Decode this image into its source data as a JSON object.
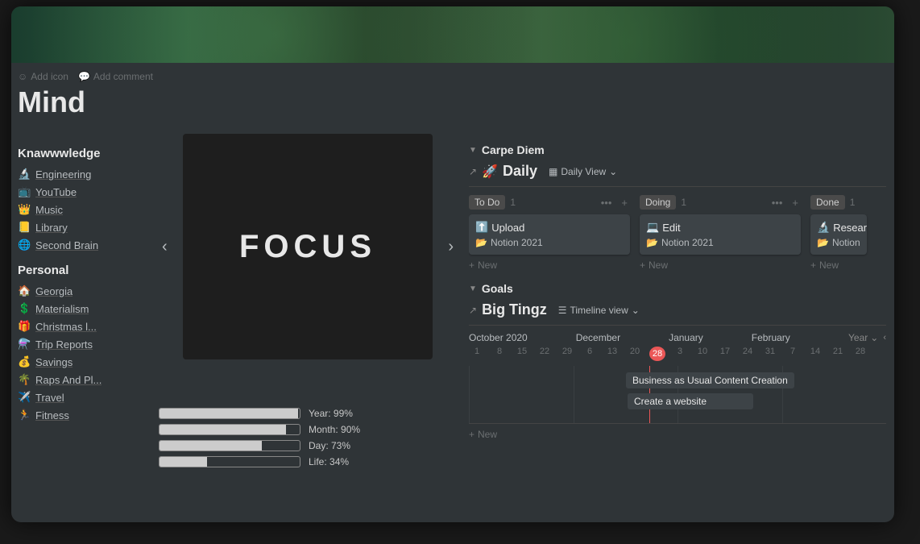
{
  "meta": {
    "add_icon": "Add icon",
    "add_comment": "Add comment"
  },
  "page_title": "Mind",
  "knowledge": {
    "heading": "Knawwwledge",
    "items": [
      {
        "emoji": "🔬",
        "label": "Engineering"
      },
      {
        "emoji": "📺",
        "label": "YouTube"
      },
      {
        "emoji": "👑",
        "label": "Music"
      },
      {
        "emoji": "📒",
        "label": "Library"
      },
      {
        "emoji": "🌐",
        "label": "Second Brain"
      }
    ]
  },
  "personal": {
    "heading": "Personal",
    "items": [
      {
        "emoji": "🏠",
        "label": "Georgia"
      },
      {
        "emoji": "💲",
        "label": "Materialism"
      },
      {
        "emoji": "🎁",
        "label": "Christmas l..."
      },
      {
        "emoji": "⚗️",
        "label": "Trip Reports"
      },
      {
        "emoji": "💰",
        "label": "Savings"
      },
      {
        "emoji": "🌴",
        "label": "Raps And Pl..."
      },
      {
        "emoji": "✈️",
        "label": "Travel"
      },
      {
        "emoji": "🏃",
        "label": "Fitness"
      }
    ]
  },
  "focus_word": "FOCUS",
  "progress": [
    {
      "label": "Year: 99%",
      "pct": 99
    },
    {
      "label": "Month: 90%",
      "pct": 90
    },
    {
      "label": "Day: 73%",
      "pct": 73
    },
    {
      "label": "Life: 34%",
      "pct": 34
    }
  ],
  "carpe": {
    "heading": "Carpe Diem",
    "db_name": "Daily",
    "db_emoji": "🚀",
    "view_label": "Daily View",
    "columns": [
      {
        "name": "To Do",
        "count": 1,
        "card_title": "Upload",
        "card_emoji": "⬆️",
        "card_sub": "Notion 2021",
        "sub_emoji": "📂"
      },
      {
        "name": "Doing",
        "count": 1,
        "card_title": "Edit",
        "card_emoji": "💻",
        "card_sub": "Notion 2021",
        "sub_emoji": "📂"
      },
      {
        "name": "Done",
        "count": 1,
        "card_title": "Resear",
        "card_emoji": "🔬",
        "card_sub": "Notion",
        "sub_emoji": "📂"
      }
    ],
    "new_label": "New"
  },
  "goals": {
    "heading": "Goals",
    "db_name": "Big Tingz",
    "view_label": "Timeline view",
    "months": [
      "October 2020",
      "December",
      "January",
      "February"
    ],
    "year_selector": "Year",
    "dates": [
      "1",
      "8",
      "15",
      "22",
      "29",
      "6",
      "13",
      "20",
      "28",
      "3",
      "10",
      "17",
      "24",
      "31",
      "7",
      "14",
      "21",
      "28"
    ],
    "today_index": 8,
    "bar1": "Business as Usual Content Creation",
    "bar2": "Create a website",
    "new_label": "New"
  }
}
